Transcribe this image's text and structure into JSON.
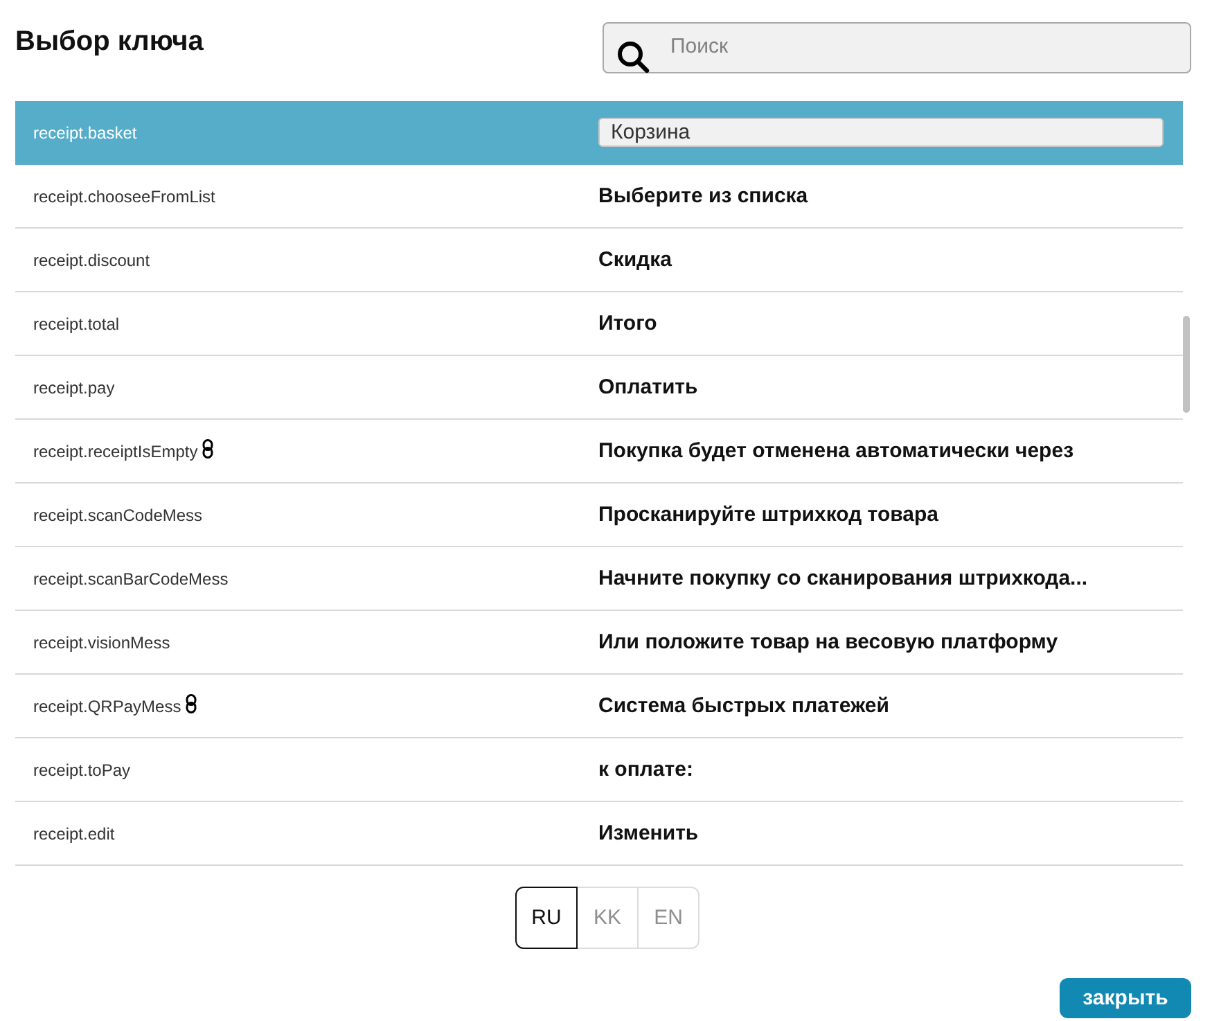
{
  "title": "Выбор ключа",
  "search": {
    "placeholder": "Поиск"
  },
  "rows": [
    {
      "key": "receipt.basket",
      "value": "Корзина",
      "selected": true,
      "linked": false
    },
    {
      "key": "receipt.chooseeFromList",
      "value": "Выберите из списка",
      "selected": false,
      "linked": false
    },
    {
      "key": "receipt.discount",
      "value": "Скидка",
      "selected": false,
      "linked": false
    },
    {
      "key": "receipt.total",
      "value": "Итого",
      "selected": false,
      "linked": false
    },
    {
      "key": "receipt.pay",
      "value": "Оплатить",
      "selected": false,
      "linked": false
    },
    {
      "key": "receipt.receiptIsEmpty",
      "value": "Покупка будет отменена автоматически через",
      "selected": false,
      "linked": true
    },
    {
      "key": "receipt.scanCodeMess",
      "value": "Просканируйте штрихкод товара",
      "selected": false,
      "linked": false
    },
    {
      "key": "receipt.scanBarCodeMess",
      "value": "Начните покупку со сканирования штрихкода...",
      "selected": false,
      "linked": false
    },
    {
      "key": "receipt.visionMess",
      "value": "Или положите товар на весовую платформу",
      "selected": false,
      "linked": false
    },
    {
      "key": "receipt.QRPayMess",
      "value": "Система быстрых платежей",
      "selected": false,
      "linked": true
    },
    {
      "key": "receipt.toPay",
      "value": "к оплате:",
      "selected": false,
      "linked": false
    },
    {
      "key": "receipt.edit",
      "value": "Изменить",
      "selected": false,
      "linked": false
    }
  ],
  "languages": [
    {
      "label": "RU",
      "selected": true
    },
    {
      "label": "KK",
      "selected": false
    },
    {
      "label": "EN",
      "selected": false
    }
  ],
  "close_button": "закрыть"
}
